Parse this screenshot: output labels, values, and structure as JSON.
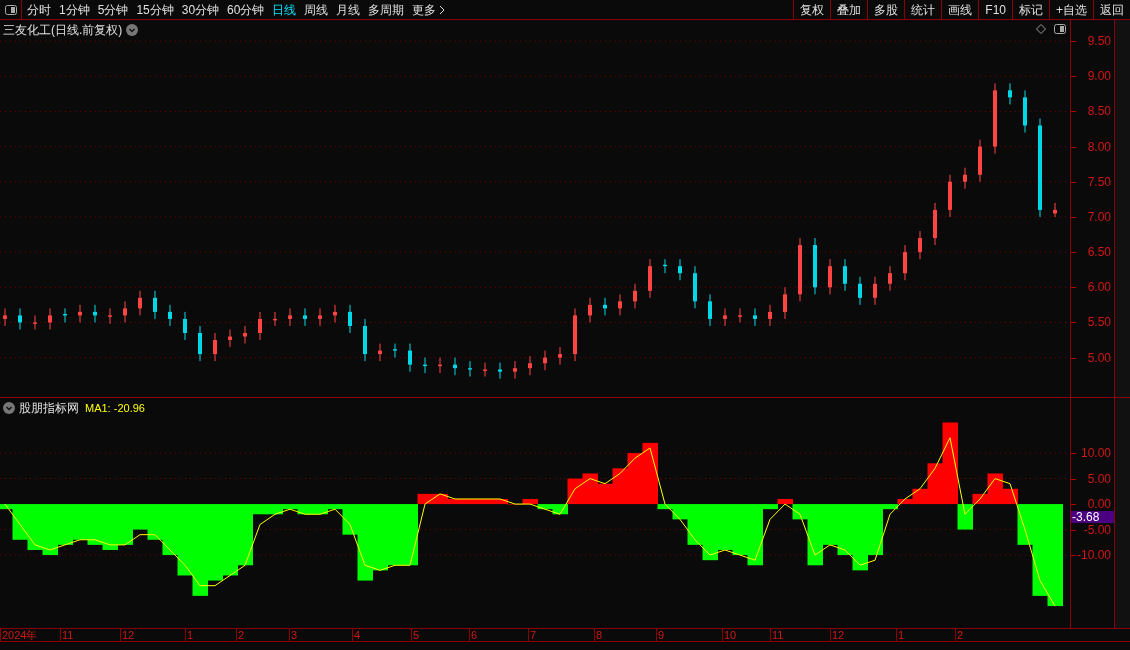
{
  "toolbar": {
    "periods": [
      {
        "label": "分时",
        "selected": false
      },
      {
        "label": "1分钟",
        "selected": false
      },
      {
        "label": "5分钟",
        "selected": false
      },
      {
        "label": "15分钟",
        "selected": false
      },
      {
        "label": "30分钟",
        "selected": false
      },
      {
        "label": "60分钟",
        "selected": false
      },
      {
        "label": "日线",
        "selected": true
      },
      {
        "label": "周线",
        "selected": false
      },
      {
        "label": "月线",
        "selected": false
      },
      {
        "label": "多周期",
        "selected": false
      }
    ],
    "more": "更多",
    "actions": [
      "复权",
      "叠加",
      "多股",
      "统计",
      "画线",
      "F10",
      "标记",
      "+自选",
      "返回"
    ]
  },
  "price_panel": {
    "title": "三友化工(日线.前复权)",
    "chart_data": {
      "type": "candlestick",
      "grid": true,
      "ylim": [
        4.44,
        9.8
      ],
      "yticks": [
        {
          "value": 5,
          "label": "5.00"
        },
        {
          "value": 5.5,
          "label": "5.50"
        },
        {
          "value": 6,
          "label": "6.00"
        },
        {
          "value": 6.5,
          "label": "6.50"
        },
        {
          "value": 7,
          "label": "7.00"
        },
        {
          "value": 7.5,
          "label": "7.50"
        },
        {
          "value": 8,
          "label": "8.00"
        },
        {
          "value": 8.5,
          "label": "8.50"
        },
        {
          "value": 9,
          "label": "9.00"
        },
        {
          "value": 9.5,
          "label": "9.50"
        }
      ],
      "ohlc": [
        [
          5.55,
          5.7,
          5.45,
          5.6
        ],
        [
          5.6,
          5.7,
          5.4,
          5.5
        ],
        [
          5.48,
          5.6,
          5.4,
          5.5
        ],
        [
          5.5,
          5.7,
          5.4,
          5.6
        ],
        [
          5.62,
          5.7,
          5.5,
          5.6
        ],
        [
          5.6,
          5.75,
          5.5,
          5.65
        ],
        [
          5.65,
          5.75,
          5.5,
          5.6
        ],
        [
          5.58,
          5.7,
          5.48,
          5.6
        ],
        [
          5.6,
          5.8,
          5.5,
          5.7
        ],
        [
          5.7,
          5.95,
          5.6,
          5.85
        ],
        [
          5.85,
          5.95,
          5.55,
          5.65
        ],
        [
          5.65,
          5.75,
          5.45,
          5.55
        ],
        [
          5.55,
          5.65,
          5.25,
          5.35
        ],
        [
          5.35,
          5.45,
          4.95,
          5.05
        ],
        [
          5.05,
          5.35,
          4.95,
          5.25
        ],
        [
          5.25,
          5.4,
          5.15,
          5.3
        ],
        [
          5.3,
          5.45,
          5.2,
          5.35
        ],
        [
          5.35,
          5.65,
          5.25,
          5.55
        ],
        [
          5.53,
          5.65,
          5.45,
          5.55
        ],
        [
          5.55,
          5.7,
          5.45,
          5.6
        ],
        [
          5.6,
          5.7,
          5.45,
          5.55
        ],
        [
          5.55,
          5.7,
          5.45,
          5.6
        ],
        [
          5.6,
          5.75,
          5.5,
          5.65
        ],
        [
          5.65,
          5.75,
          5.35,
          5.45
        ],
        [
          5.45,
          5.55,
          4.95,
          5.05
        ],
        [
          5.05,
          5.2,
          4.95,
          5.1
        ],
        [
          5.12,
          5.2,
          5.0,
          5.1
        ],
        [
          5.1,
          5.2,
          4.8,
          4.9
        ],
        [
          4.9,
          5.0,
          4.78,
          4.88
        ],
        [
          4.88,
          5.0,
          4.78,
          4.9
        ],
        [
          4.9,
          5.0,
          4.75,
          4.85
        ],
        [
          4.85,
          4.95,
          4.73,
          4.83
        ],
        [
          4.81,
          4.93,
          4.73,
          4.83
        ],
        [
          4.83,
          4.93,
          4.7,
          4.8
        ],
        [
          4.8,
          4.95,
          4.7,
          4.85
        ],
        [
          4.85,
          5.02,
          4.75,
          4.92
        ],
        [
          4.92,
          5.1,
          4.82,
          5.0
        ],
        [
          5.0,
          5.15,
          4.9,
          5.05
        ],
        [
          5.05,
          5.7,
          4.95,
          5.6
        ],
        [
          5.6,
          5.85,
          5.5,
          5.75
        ],
        [
          5.75,
          5.85,
          5.6,
          5.7
        ],
        [
          5.7,
          5.9,
          5.6,
          5.8
        ],
        [
          5.8,
          6.05,
          5.7,
          5.95
        ],
        [
          5.95,
          6.4,
          5.85,
          6.3
        ],
        [
          6.32,
          6.4,
          6.2,
          6.3
        ],
        [
          6.3,
          6.4,
          6.1,
          6.2
        ],
        [
          6.2,
          6.3,
          5.7,
          5.8
        ],
        [
          5.8,
          5.9,
          5.45,
          5.55
        ],
        [
          5.55,
          5.7,
          5.45,
          5.6
        ],
        [
          5.58,
          5.7,
          5.5,
          5.6
        ],
        [
          5.6,
          5.7,
          5.45,
          5.55
        ],
        [
          5.55,
          5.75,
          5.45,
          5.65
        ],
        [
          5.65,
          6.0,
          5.55,
          5.9
        ],
        [
          5.9,
          6.7,
          5.8,
          6.6
        ],
        [
          6.6,
          6.7,
          5.9,
          6.0
        ],
        [
          6.0,
          6.4,
          5.9,
          6.3
        ],
        [
          6.3,
          6.4,
          5.95,
          6.05
        ],
        [
          6.05,
          6.15,
          5.75,
          5.85
        ],
        [
          5.85,
          6.15,
          5.75,
          6.05
        ],
        [
          6.05,
          6.3,
          5.95,
          6.2
        ],
        [
          6.2,
          6.6,
          6.1,
          6.5
        ],
        [
          6.5,
          6.8,
          6.4,
          6.7
        ],
        [
          6.7,
          7.2,
          6.6,
          7.1
        ],
        [
          7.1,
          7.6,
          7.0,
          7.5
        ],
        [
          7.5,
          7.7,
          7.4,
          7.6
        ],
        [
          7.6,
          8.1,
          7.5,
          8.0
        ],
        [
          8.0,
          8.9,
          7.9,
          8.8
        ],
        [
          8.8,
          8.9,
          8.6,
          8.7
        ],
        [
          8.7,
          8.8,
          8.2,
          8.3
        ],
        [
          8.3,
          8.4,
          7.0,
          7.1
        ],
        [
          7.05,
          7.2,
          7.0,
          7.1
        ]
      ]
    }
  },
  "indicator_panel": {
    "name": "股朋指标网",
    "ma_label": "MA1: -20.96",
    "current_value": "-3.68",
    "time_labels": [
      "2024年",
      "11",
      "12",
      "1",
      "2",
      "3",
      "4",
      "5",
      "6",
      "7",
      "8",
      "9",
      "10",
      "11",
      "12",
      "1",
      "2"
    ],
    "chart_data": {
      "type": "bar",
      "grid": true,
      "ylim": [
        -24.3,
        20.8
      ],
      "yticks": [
        {
          "value": -10,
          "label": "-10.00"
        },
        {
          "value": -5,
          "label": "-5.00"
        },
        {
          "value": 0,
          "label": "0.00"
        },
        {
          "value": 5,
          "label": "5.00"
        },
        {
          "value": 10,
          "label": "10.00"
        }
      ],
      "series": [
        {
          "color": "#ff0000",
          "values": [
            null,
            null,
            null,
            null,
            null,
            null,
            null,
            null,
            null,
            null,
            null,
            null,
            null,
            null,
            null,
            null,
            null,
            null,
            null,
            null,
            null,
            null,
            null,
            null,
            null,
            null,
            null,
            null,
            2,
            2,
            1,
            1,
            1,
            1,
            0,
            1,
            null,
            null,
            5,
            6,
            4,
            7,
            10,
            12,
            null,
            null,
            null,
            null,
            null,
            null,
            null,
            null,
            1,
            null,
            null,
            null,
            null,
            null,
            null,
            null,
            1,
            3,
            8,
            16,
            null,
            2,
            6,
            3,
            null,
            null,
            null
          ]
        },
        {
          "color": "#00ff00",
          "values": [
            -1,
            -7,
            -9,
            -10,
            -8,
            -7,
            -8,
            -9,
            -8,
            -5,
            -7,
            -10,
            -14,
            -18,
            -15,
            -14,
            -12,
            -2,
            -2,
            -1,
            -2,
            -2,
            -1,
            -6,
            -15,
            -13,
            -12,
            -12,
            null,
            null,
            null,
            null,
            null,
            null,
            null,
            null,
            -1,
            -2,
            null,
            null,
            null,
            null,
            null,
            null,
            -1,
            -3,
            -8,
            -11,
            -9,
            -10,
            -12,
            -1,
            null,
            -3,
            -12,
            -8,
            -10,
            -13,
            -10,
            -1,
            null,
            null,
            null,
            null,
            -5,
            null,
            null,
            null,
            -8,
            -18,
            -20
          ]
        },
        {
          "type": "line",
          "color": "#ffff00",
          "values": [
            0,
            -4,
            -8,
            -9,
            -8,
            -7,
            -7,
            -8,
            -8,
            -6,
            -6,
            -9,
            -12,
            -16,
            -16,
            -14,
            -12,
            -4,
            -2,
            -1,
            -2,
            -2,
            -1,
            -4,
            -12,
            -13,
            -12,
            -12,
            0,
            2,
            1,
            1,
            1,
            1,
            0,
            0,
            -1,
            -2,
            3,
            5,
            4,
            6,
            9,
            11,
            0,
            -3,
            -7,
            -10,
            -9,
            -10,
            -11,
            -3,
            0,
            -2,
            -10,
            -8,
            -9,
            -12,
            -11,
            -2,
            1,
            3,
            7,
            13,
            -2,
            1,
            5,
            4,
            -5,
            -15,
            -20
          ]
        }
      ]
    }
  }
}
